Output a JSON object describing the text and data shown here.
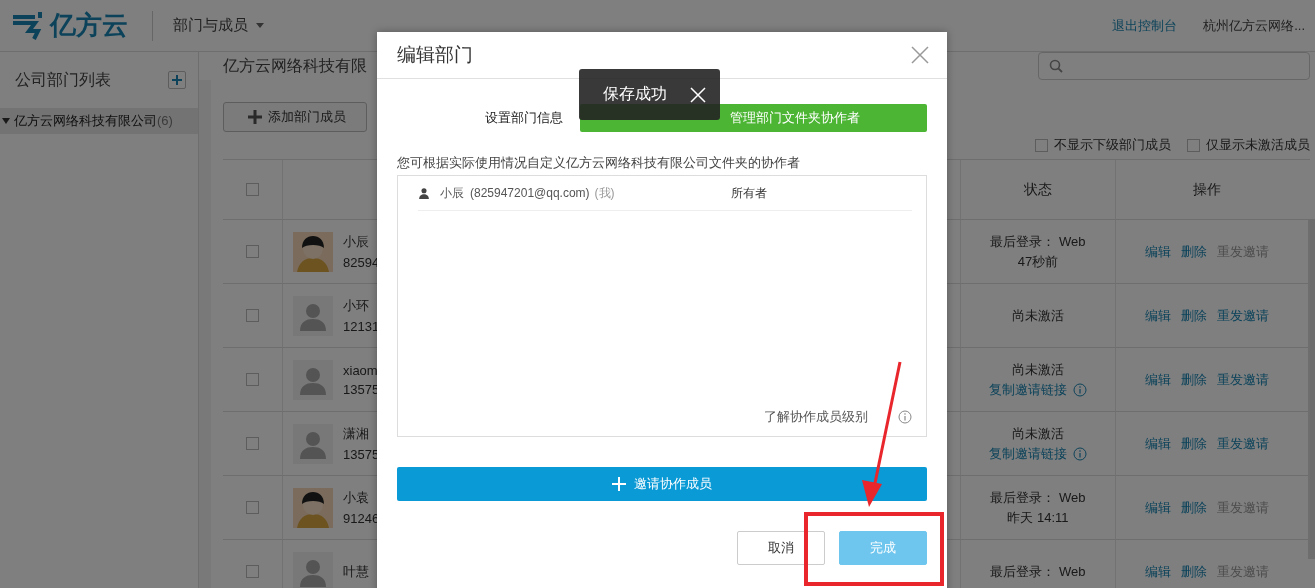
{
  "header": {
    "logo_text": "亿方云",
    "nav_menu": "部门与成员",
    "exit_link": "退出控制台",
    "account": "杭州亿方云网络..."
  },
  "sidebar": {
    "title": "公司部门列表",
    "tree": [
      {
        "label": "亿方云网络科技有限公司",
        "count": "(6)",
        "expanded": true,
        "selected": true
      }
    ]
  },
  "main": {
    "title": "亿方云网络科技有限",
    "add_button": "添加部门成员",
    "filters": [
      {
        "label": "不显示下级部门成员",
        "checked": false
      },
      {
        "label": "仅显示未激活成员",
        "checked": false
      }
    ],
    "table": {
      "select_all": false,
      "columns": [
        "状态",
        "操作"
      ],
      "rows": [
        {
          "checked": false,
          "avatar": {
            "kind": "photo"
          },
          "name": "小辰",
          "id": "82594",
          "status_lines": [
            "最后登录： Web",
            "47秒前"
          ],
          "actions": [
            {
              "label": "编辑",
              "disabled": false
            },
            {
              "label": "删除",
              "disabled": false
            },
            {
              "label": "重发邀请",
              "disabled": true
            }
          ]
        },
        {
          "checked": false,
          "avatar": {
            "kind": "default"
          },
          "name": "小环",
          "id": "12131",
          "status_lines": [
            "尚未激活"
          ],
          "actions": [
            {
              "label": "编辑",
              "disabled": false
            },
            {
              "label": "删除",
              "disabled": false
            },
            {
              "label": "重发邀请",
              "disabled": false
            }
          ]
        },
        {
          "checked": false,
          "avatar": {
            "kind": "default"
          },
          "name": "xiaom",
          "id": "13575",
          "status_lines": [
            "尚未激活"
          ],
          "copy_link": "复制邀请链接",
          "actions": [
            {
              "label": "编辑",
              "disabled": false
            },
            {
              "label": "删除",
              "disabled": false
            },
            {
              "label": "重发邀请",
              "disabled": false
            }
          ]
        },
        {
          "checked": false,
          "avatar": {
            "kind": "default"
          },
          "name": "潇湘",
          "id": "13575",
          "status_lines": [
            "尚未激活"
          ],
          "copy_link": "复制邀请链接",
          "actions": [
            {
              "label": "编辑",
              "disabled": false
            },
            {
              "label": "删除",
              "disabled": false
            },
            {
              "label": "重发邀请",
              "disabled": false
            }
          ]
        },
        {
          "checked": false,
          "avatar": {
            "kind": "photo"
          },
          "name": "小袁",
          "id": "91246",
          "status_lines": [
            "最后登录： Web",
            "昨天 14:11"
          ],
          "actions": [
            {
              "label": "编辑",
              "disabled": false
            },
            {
              "label": "删除",
              "disabled": false
            },
            {
              "label": "重发邀请",
              "disabled": true
            }
          ]
        },
        {
          "checked": false,
          "avatar": {
            "kind": "default"
          },
          "name": "叶慧",
          "status_lines": [
            "最后登录： Web"
          ],
          "actions": [
            {
              "label": "编辑",
              "disabled": false
            },
            {
              "label": "删除",
              "disabled": false
            },
            {
              "label": "重发邀请",
              "disabled": true
            }
          ]
        }
      ]
    }
  },
  "dialog": {
    "title": "编辑部门",
    "steps": [
      {
        "label": "设置部门信息",
        "selected": false
      },
      {
        "label": "管理部门文件夹协作者",
        "selected": true
      }
    ],
    "toast": "保存成功",
    "description": "您可根据实际使用情况自定义亿方云网络科技有限公司文件夹的协作者",
    "collaborators": [
      {
        "name": "小辰",
        "email": "(825947201@qq.com)",
        "me_tag": "(我)",
        "role": "所有者"
      }
    ],
    "levels_link": "了解协作成员级别",
    "invite_button": "邀请协作成员",
    "buttons": [
      {
        "label": "取消",
        "kind": "secondary"
      },
      {
        "label": "完成",
        "kind": "primary"
      }
    ]
  }
}
